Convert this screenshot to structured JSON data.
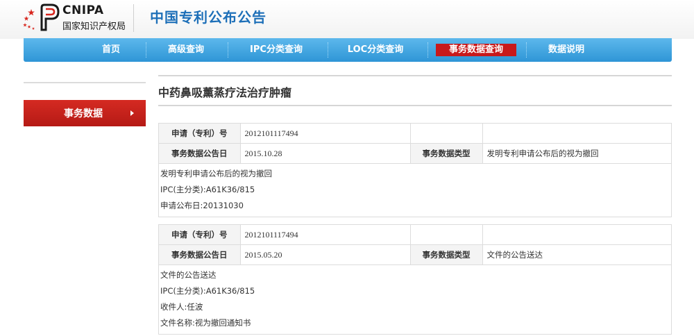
{
  "header": {
    "logo_en": "CNIPA",
    "logo_cn": "国家知识产权局",
    "site_title": "中国专利公布公告"
  },
  "nav": {
    "items": [
      "首页",
      "高级查询",
      "IPC分类查询",
      "LOC分类查询",
      "事务数据查询",
      "数据说明"
    ],
    "active_index": 4
  },
  "sidebar": {
    "active_item": "事务数据"
  },
  "page_title": "中药鼻吸薰蒸疗法治疗肿瘤",
  "labels": {
    "application_no": "申请（专利）号",
    "announce_date": "事务数据公告日",
    "data_type": "事务数据类型"
  },
  "records": [
    {
      "application_no": "2012101117494",
      "announce_date": "2015.10.28",
      "data_type": "发明专利申请公布后的视为撤回",
      "details": [
        "发明专利申请公布后的视为撤回",
        "IPC(主分类):A61K36/815",
        "申请公布日:20131030"
      ]
    },
    {
      "application_no": "2012101117494",
      "announce_date": "2015.05.20",
      "data_type": "文件的公告送达",
      "details": [
        "文件的公告送达",
        "IPC(主分类):A61K36/815",
        "收件人:任波",
        "文件名称:视为撤回通知书"
      ]
    }
  ],
  "colors": {
    "brand_blue": "#1d6fb8",
    "nav_blue": "#3ea6e2",
    "active_red": "#c8191b"
  }
}
